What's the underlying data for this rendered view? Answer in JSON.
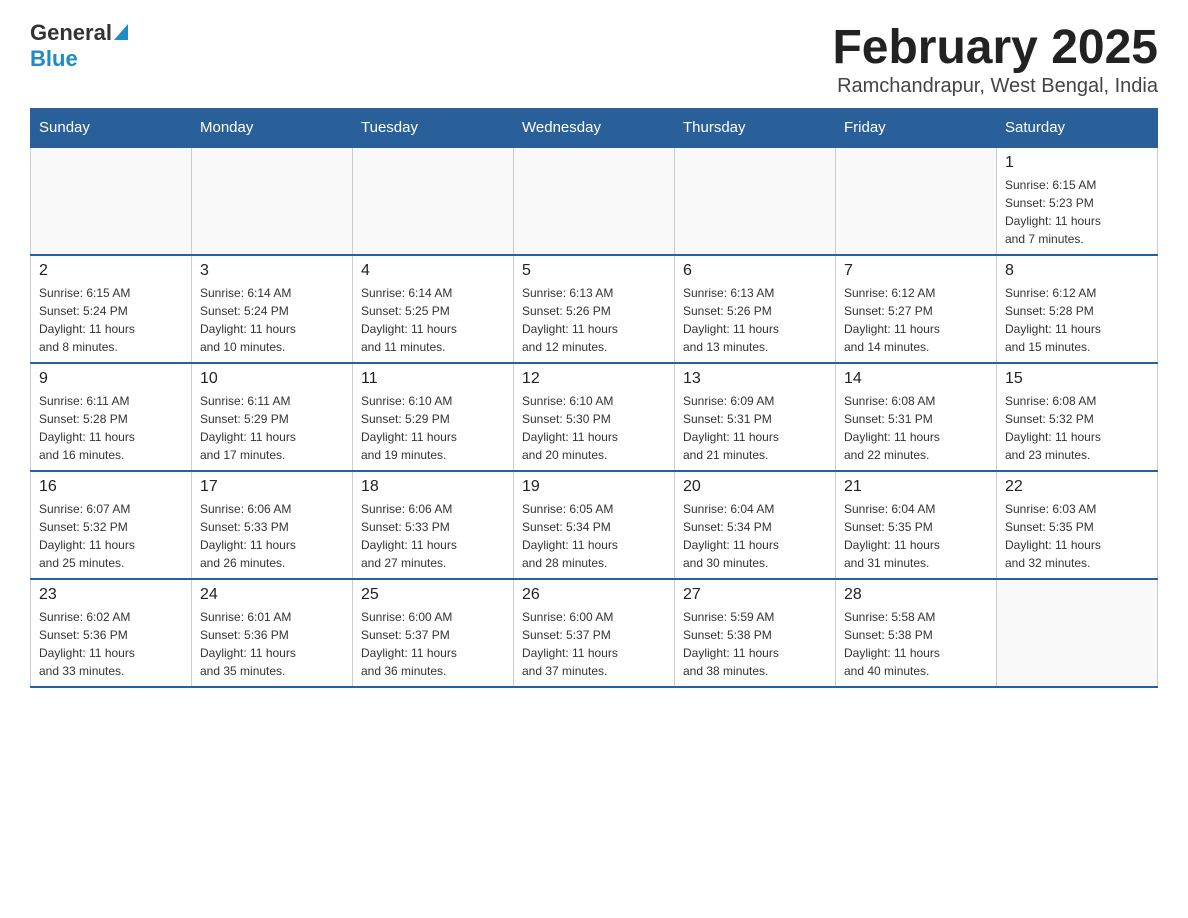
{
  "header": {
    "logo_general": "General",
    "logo_blue": "Blue",
    "title": "February 2025",
    "location": "Ramchandrapur, West Bengal, India"
  },
  "weekdays": [
    "Sunday",
    "Monday",
    "Tuesday",
    "Wednesday",
    "Thursday",
    "Friday",
    "Saturday"
  ],
  "weeks": [
    [
      {
        "day": "",
        "info": ""
      },
      {
        "day": "",
        "info": ""
      },
      {
        "day": "",
        "info": ""
      },
      {
        "day": "",
        "info": ""
      },
      {
        "day": "",
        "info": ""
      },
      {
        "day": "",
        "info": ""
      },
      {
        "day": "1",
        "info": "Sunrise: 6:15 AM\nSunset: 5:23 PM\nDaylight: 11 hours\nand 7 minutes."
      }
    ],
    [
      {
        "day": "2",
        "info": "Sunrise: 6:15 AM\nSunset: 5:24 PM\nDaylight: 11 hours\nand 8 minutes."
      },
      {
        "day": "3",
        "info": "Sunrise: 6:14 AM\nSunset: 5:24 PM\nDaylight: 11 hours\nand 10 minutes."
      },
      {
        "day": "4",
        "info": "Sunrise: 6:14 AM\nSunset: 5:25 PM\nDaylight: 11 hours\nand 11 minutes."
      },
      {
        "day": "5",
        "info": "Sunrise: 6:13 AM\nSunset: 5:26 PM\nDaylight: 11 hours\nand 12 minutes."
      },
      {
        "day": "6",
        "info": "Sunrise: 6:13 AM\nSunset: 5:26 PM\nDaylight: 11 hours\nand 13 minutes."
      },
      {
        "day": "7",
        "info": "Sunrise: 6:12 AM\nSunset: 5:27 PM\nDaylight: 11 hours\nand 14 minutes."
      },
      {
        "day": "8",
        "info": "Sunrise: 6:12 AM\nSunset: 5:28 PM\nDaylight: 11 hours\nand 15 minutes."
      }
    ],
    [
      {
        "day": "9",
        "info": "Sunrise: 6:11 AM\nSunset: 5:28 PM\nDaylight: 11 hours\nand 16 minutes."
      },
      {
        "day": "10",
        "info": "Sunrise: 6:11 AM\nSunset: 5:29 PM\nDaylight: 11 hours\nand 17 minutes."
      },
      {
        "day": "11",
        "info": "Sunrise: 6:10 AM\nSunset: 5:29 PM\nDaylight: 11 hours\nand 19 minutes."
      },
      {
        "day": "12",
        "info": "Sunrise: 6:10 AM\nSunset: 5:30 PM\nDaylight: 11 hours\nand 20 minutes."
      },
      {
        "day": "13",
        "info": "Sunrise: 6:09 AM\nSunset: 5:31 PM\nDaylight: 11 hours\nand 21 minutes."
      },
      {
        "day": "14",
        "info": "Sunrise: 6:08 AM\nSunset: 5:31 PM\nDaylight: 11 hours\nand 22 minutes."
      },
      {
        "day": "15",
        "info": "Sunrise: 6:08 AM\nSunset: 5:32 PM\nDaylight: 11 hours\nand 23 minutes."
      }
    ],
    [
      {
        "day": "16",
        "info": "Sunrise: 6:07 AM\nSunset: 5:32 PM\nDaylight: 11 hours\nand 25 minutes."
      },
      {
        "day": "17",
        "info": "Sunrise: 6:06 AM\nSunset: 5:33 PM\nDaylight: 11 hours\nand 26 minutes."
      },
      {
        "day": "18",
        "info": "Sunrise: 6:06 AM\nSunset: 5:33 PM\nDaylight: 11 hours\nand 27 minutes."
      },
      {
        "day": "19",
        "info": "Sunrise: 6:05 AM\nSunset: 5:34 PM\nDaylight: 11 hours\nand 28 minutes."
      },
      {
        "day": "20",
        "info": "Sunrise: 6:04 AM\nSunset: 5:34 PM\nDaylight: 11 hours\nand 30 minutes."
      },
      {
        "day": "21",
        "info": "Sunrise: 6:04 AM\nSunset: 5:35 PM\nDaylight: 11 hours\nand 31 minutes."
      },
      {
        "day": "22",
        "info": "Sunrise: 6:03 AM\nSunset: 5:35 PM\nDaylight: 11 hours\nand 32 minutes."
      }
    ],
    [
      {
        "day": "23",
        "info": "Sunrise: 6:02 AM\nSunset: 5:36 PM\nDaylight: 11 hours\nand 33 minutes."
      },
      {
        "day": "24",
        "info": "Sunrise: 6:01 AM\nSunset: 5:36 PM\nDaylight: 11 hours\nand 35 minutes."
      },
      {
        "day": "25",
        "info": "Sunrise: 6:00 AM\nSunset: 5:37 PM\nDaylight: 11 hours\nand 36 minutes."
      },
      {
        "day": "26",
        "info": "Sunrise: 6:00 AM\nSunset: 5:37 PM\nDaylight: 11 hours\nand 37 minutes."
      },
      {
        "day": "27",
        "info": "Sunrise: 5:59 AM\nSunset: 5:38 PM\nDaylight: 11 hours\nand 38 minutes."
      },
      {
        "day": "28",
        "info": "Sunrise: 5:58 AM\nSunset: 5:38 PM\nDaylight: 11 hours\nand 40 minutes."
      },
      {
        "day": "",
        "info": ""
      }
    ]
  ]
}
